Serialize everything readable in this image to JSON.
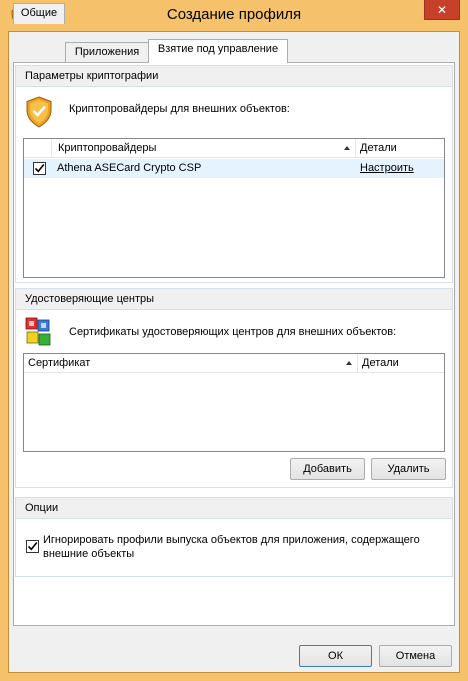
{
  "window": {
    "title": "Создание профиля",
    "close_glyph": "✕"
  },
  "tabs": [
    {
      "label": "Общие",
      "active": false
    },
    {
      "label": "Приложения",
      "active": false
    },
    {
      "label": "Взятие под управление",
      "active": true
    }
  ],
  "crypto_group": {
    "header": "Параметры криптографии",
    "icon": "shield-icon",
    "description": "Криптопровайдеры для внешних объектов:",
    "columns": [
      "Криптопровайдеры",
      "Детали"
    ],
    "rows": [
      {
        "checked": true,
        "name": "Athena ASECard Crypto CSP",
        "details": "Настроить"
      }
    ]
  },
  "ca_group": {
    "header": "Удостоверяющие центры",
    "icon": "certificate-blocks-icon",
    "description": "Сертификаты удостоверяющих центров для внешних объектов:",
    "columns": [
      "Сертификат",
      "Детали"
    ],
    "add_label": "Добавить",
    "remove_label": "Удалить"
  },
  "options_group": {
    "header": "Опции",
    "ignore_checked": true,
    "ignore_label_line1": "Игнорировать профили выпуска объектов для приложения, содержащего",
    "ignore_label_line2": "внешние объекты"
  },
  "footer": {
    "ok_label": "ОК",
    "cancel_label": "Отмена"
  },
  "colors": {
    "frame": "#f5c26b",
    "close": "#c7402a",
    "selected_row": "#e5f3ff"
  }
}
